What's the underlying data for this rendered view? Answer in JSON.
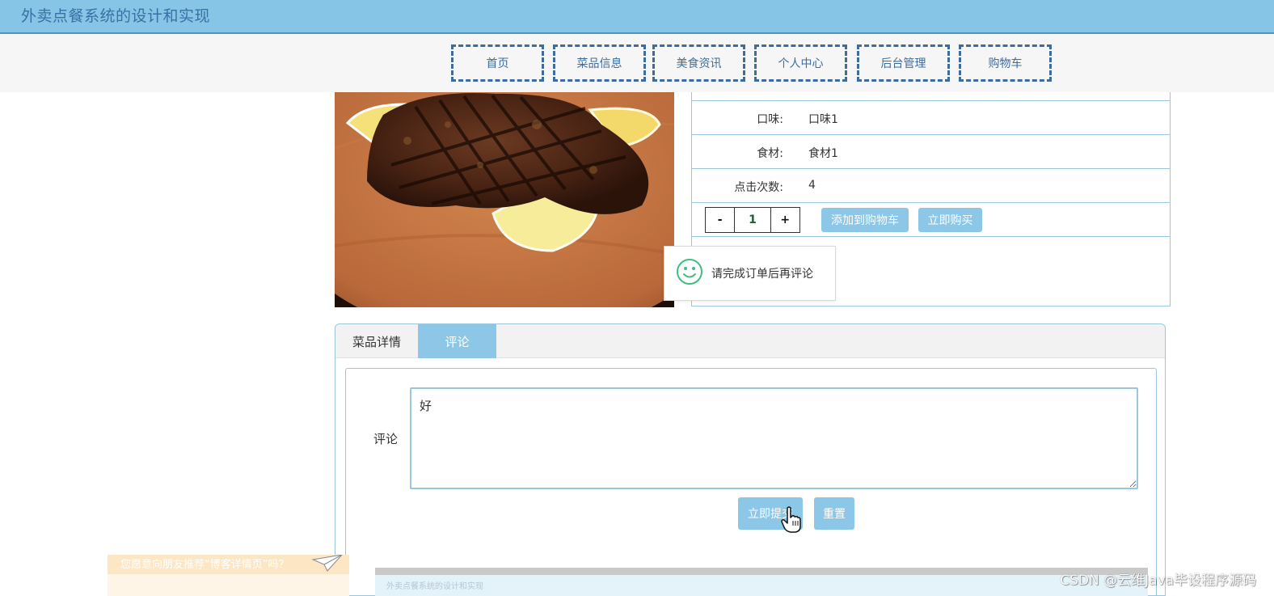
{
  "app": {
    "title": "外卖点餐系统的设计和实现"
  },
  "nav": {
    "items": [
      "首页",
      "菜品信息",
      "美食资讯",
      "个人中心",
      "后台管理",
      "购物车"
    ]
  },
  "product": {
    "image_icon": "grilled-steak-photo",
    "attributes": [
      {
        "label": "口味:",
        "value": "口味1"
      },
      {
        "label": "食材:",
        "value": "食材1"
      },
      {
        "label": "点击次数:",
        "value": "4"
      }
    ],
    "quantity": {
      "minus": "-",
      "value": "1",
      "plus": "+"
    },
    "add_to_cart": "添加到购物车",
    "buy_now": "立即购买"
  },
  "toast": {
    "icon": "smiley-icon",
    "message": "请完成订单后再评论"
  },
  "tabs": {
    "details": "菜品详情",
    "comments": "评论"
  },
  "comment_form": {
    "label": "评论",
    "value": "好",
    "submit": "立即提交",
    "reset": "重置"
  },
  "ad": {
    "text": "您愿意向朋友推荐“博客详情页”吗？",
    "icon": "paper-plane-icon"
  },
  "preview": {
    "text": "外卖点餐系统的设计和实现"
  },
  "watermark": "CSDN @云维Java毕设程序源码",
  "colors": {
    "header_bg": "#87c5e6",
    "accent": "#8cc7e7",
    "nav_border": "#3d6d9e",
    "toast_icon": "#3fbf7f"
  }
}
